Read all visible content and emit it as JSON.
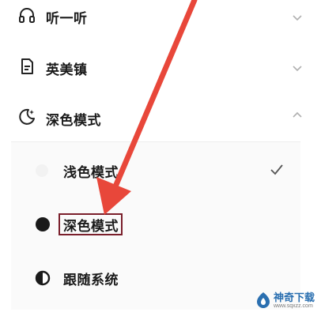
{
  "menu": [
    {
      "label": "听一听",
      "icon": "headphones-icon",
      "expanded": false
    },
    {
      "label": "英美镇",
      "icon": "document-icon",
      "expanded": false
    },
    {
      "label": "深色模式",
      "icon": "moon-sparkle-icon",
      "expanded": true
    }
  ],
  "theme_options": [
    {
      "label": "浅色模式",
      "icon": "light-dot-icon",
      "selected": true
    },
    {
      "label": "深色模式",
      "icon": "dark-dot-icon",
      "selected": false
    },
    {
      "label": "跟随系统",
      "icon": "half-circle-icon",
      "selected": false
    }
  ],
  "annotation": {
    "arrow_color": "#e8473a",
    "box_color": "#7a1f2b"
  },
  "watermark": {
    "title": "神奇下载",
    "url": "www.sqxzz.com"
  }
}
